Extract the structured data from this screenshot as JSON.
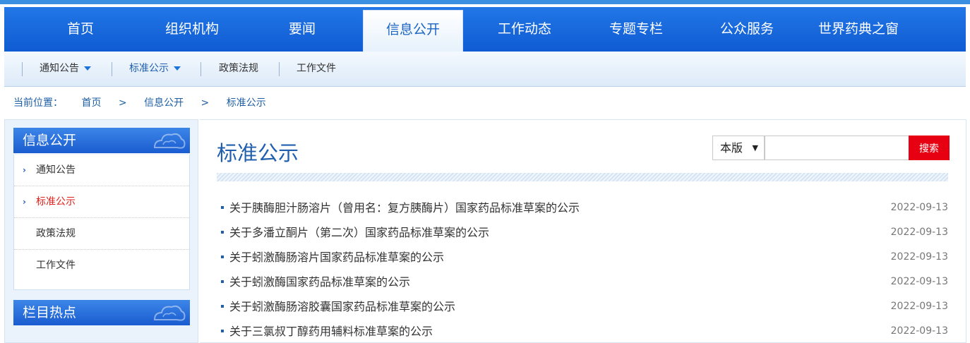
{
  "nav": {
    "items": [
      "首页",
      "组织机构",
      "要闻",
      "信息公开",
      "工作动态",
      "专题专栏",
      "公众服务",
      "世界药典之窗"
    ],
    "active_index": 3
  },
  "subnav": {
    "items": [
      "通知公告",
      "标准公示",
      "政策法规",
      "工作文件"
    ],
    "active_index": 1
  },
  "breadcrumb": {
    "label": "当前位置：",
    "items": [
      "首页",
      "信息公开",
      "标准公示"
    ],
    "separator": ">"
  },
  "sidebar": {
    "section_title": "信息公开",
    "items": [
      "通知公告",
      "标准公示",
      "政策法规",
      "工作文件"
    ],
    "active_index": 1,
    "hot_title": "栏目热点"
  },
  "main": {
    "title": "标准公示",
    "search": {
      "scope": "本版",
      "scope_arrow": "▼",
      "placeholder": "",
      "button": "搜索"
    },
    "articles": [
      {
        "title": "关于胰酶胆汁肠溶片（曾用名：复方胰酶片）国家药品标准草案的公示",
        "date": "2022-09-13"
      },
      {
        "title": "关于多潘立酮片（第二次）国家药品标准草案的公示",
        "date": "2022-09-13"
      },
      {
        "title": "关于蚓激酶肠溶片国家药品标准草案的公示",
        "date": "2022-09-13"
      },
      {
        "title": "关于蚓激酶国家药品标准草案的公示",
        "date": "2022-09-13"
      },
      {
        "title": "关于蚓激酶肠溶胶囊国家药品标准草案的公示",
        "date": "2022-09-13"
      },
      {
        "title": "关于三氯叔丁醇药用辅料标准草案的公示",
        "date": "2022-09-13"
      }
    ]
  },
  "colors": {
    "nav_blue": "#1a64d9",
    "link_blue": "#1f5fae",
    "active_red": "#e0201a",
    "search_red": "#e60012"
  }
}
